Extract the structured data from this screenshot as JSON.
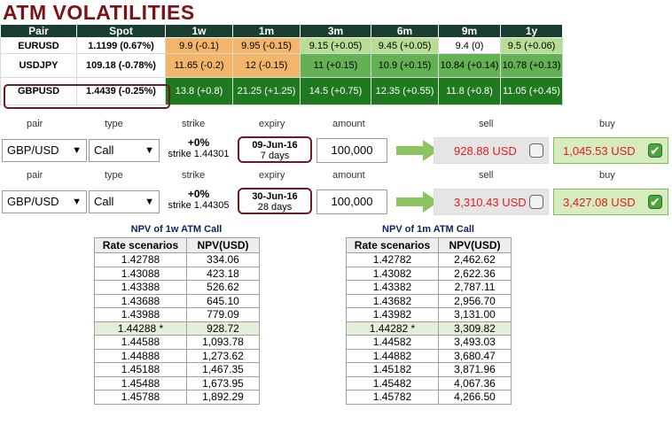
{
  "title": "ATM VOLATILITIES",
  "vol_table": {
    "headers": [
      "Pair",
      "Spot",
      "1w",
      "1m",
      "3m",
      "6m",
      "9m",
      "1y"
    ],
    "rows": [
      {
        "pair": "EURUSD",
        "spot": "1.1199 (0.67%)",
        "cells": [
          "9.9 (-0.1)",
          "9.95 (-0.15)",
          "9.15 (+0.05)",
          "9.45 (+0.05)",
          "9.4 (0)",
          "9.5 (+0.06)"
        ],
        "colors": [
          "#f3b56a",
          "#f3b56a",
          "#b7dc93",
          "#b7dc93",
          "#ffffff",
          "#b7dc93"
        ]
      },
      {
        "pair": "USDJPY",
        "spot": "109.18 (-0.78%)",
        "cells": [
          "11.65 (-0.2)",
          "12 (-0.15)",
          "11 (+0.15)",
          "10.9 (+0.15)",
          "10.84 (+0.14)",
          "10.78 (+0.13)"
        ],
        "colors": [
          "#f3b56a",
          "#f3b56a",
          "#64b154",
          "#64b154",
          "#64b154",
          "#64b154"
        ]
      },
      {
        "pair": "GBPUSD",
        "spot": "1.4439 (-0.25%)",
        "cells": [
          "13.8 (+0.8)",
          "21.25 (+1.25)",
          "14.5 (+0.75)",
          "12.35 (+0.55)",
          "11.8 (+0.8)",
          "11.05 (+0.45)"
        ],
        "colors": [
          "#1f7a1f",
          "#1f7a1f",
          "#1f7a1f",
          "#1f7a1f",
          "#1f7a1f",
          "#1f7a1f"
        ]
      }
    ]
  },
  "labels": {
    "pair": "pair",
    "type": "type",
    "strike": "strike",
    "expiry": "expiry",
    "amount": "amount",
    "sell": "sell",
    "buy": "buy"
  },
  "pricer1": {
    "pair": "GBP/USD",
    "type": "Call",
    "strike_pct": "+0%",
    "strike_val": "strike 1.44301",
    "expiry_date": "09-Jun-16",
    "expiry_days": "7 days",
    "amount": "100,000",
    "sell": "928.88 USD",
    "buy": "1,045.53 USD",
    "sell_checked": false,
    "buy_checked": true
  },
  "pricer2": {
    "pair": "GBP/USD",
    "type": "Call",
    "strike_pct": "+0%",
    "strike_val": "strike 1.44305",
    "expiry_date": "30-Jun-16",
    "expiry_days": "28 days",
    "amount": "100,000",
    "sell": "3,310.43 USD",
    "buy": "3,427.08 USD",
    "sell_checked": false,
    "buy_checked": true
  },
  "npv1": {
    "title": "NPV of 1w ATM Call",
    "headers": [
      "Rate scenarios",
      "NPV(USD)"
    ],
    "rows": [
      [
        "1.42788",
        "334.06"
      ],
      [
        "1.43088",
        "423.18"
      ],
      [
        "1.43388",
        "526.62"
      ],
      [
        "1.43688",
        "645.10"
      ],
      [
        "1.43988",
        "779.09"
      ],
      [
        "1.44288 *",
        "928.72"
      ],
      [
        "1.44588",
        "1,093.78"
      ],
      [
        "1.44888",
        "1,273.62"
      ],
      [
        "1.45188",
        "1,467.35"
      ],
      [
        "1.45488",
        "1,673.95"
      ],
      [
        "1.45788",
        "1,892.29"
      ]
    ],
    "atm_index": 5
  },
  "npv2": {
    "title": "NPV of 1m ATM Call",
    "headers": [
      "Rate scenarios",
      "NPV(USD)"
    ],
    "rows": [
      [
        "1.42782",
        "2,462.62"
      ],
      [
        "1.43082",
        "2,622.36"
      ],
      [
        "1.43382",
        "2,787.11"
      ],
      [
        "1.43682",
        "2,956.70"
      ],
      [
        "1.43982",
        "3,131.00"
      ],
      [
        "1.44282 *",
        "3,309.82"
      ],
      [
        "1.44582",
        "3,493.03"
      ],
      [
        "1.44882",
        "3,680.47"
      ],
      [
        "1.45182",
        "3,871.96"
      ],
      [
        "1.45482",
        "4,067.36"
      ],
      [
        "1.45782",
        "4,266.50"
      ]
    ],
    "atm_index": 5
  }
}
